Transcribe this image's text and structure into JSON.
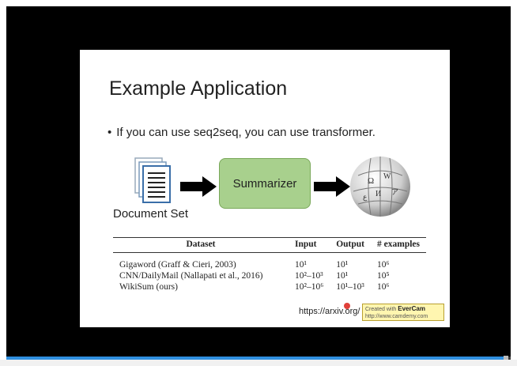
{
  "player": {
    "progress_fraction": 0.99,
    "progress_color": "#2f8fe0"
  },
  "slide": {
    "title": "Example Application",
    "bullet": "If you can use seq2seq, you can use transformer.",
    "diagram": {
      "document_label": "Document Set",
      "summarizer_label": "Summarizer",
      "summarizer_color": "#a8d08d",
      "icons": [
        "document-stack-icon",
        "arrow-right-icon",
        "wikipedia-globe-icon"
      ]
    },
    "table": {
      "headers": [
        "Dataset",
        "Input",
        "Output",
        "# examples"
      ],
      "rows": [
        [
          "Gigaword (Graff & Cieri, 2003)",
          "10¹",
          "10¹",
          "10⁶"
        ],
        [
          "CNN/DailyMail (Nallapati et al., 2016)",
          "10²–10³",
          "10¹",
          "10⁵"
        ],
        [
          "WikiSum (ours)",
          "10²–10⁶",
          "10¹–10³",
          "10⁶"
        ]
      ]
    },
    "source_url": "https://arxiv.org/"
  },
  "watermark": {
    "line1_prefix": "Created with",
    "brand": "EverCam",
    "line2": "http://www.camdemy.com"
  }
}
